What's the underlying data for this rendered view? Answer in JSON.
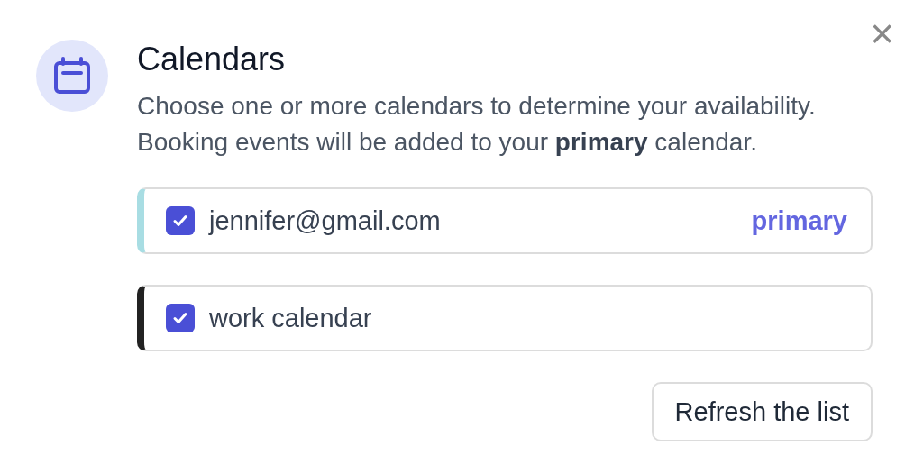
{
  "dialog": {
    "title": "Calendars",
    "description": "Choose one or more calendars to determine your availability. Booking events will be added to your **primary** calendar.",
    "close_label": "×"
  },
  "calendars": [
    {
      "name": "jennifer@gmail.com",
      "checked": true,
      "color": "#a8dde3",
      "badge": "primary"
    },
    {
      "name": "work calendar",
      "checked": true,
      "color": "#222222"
    }
  ],
  "buttons": [
    "Refresh the list"
  ]
}
